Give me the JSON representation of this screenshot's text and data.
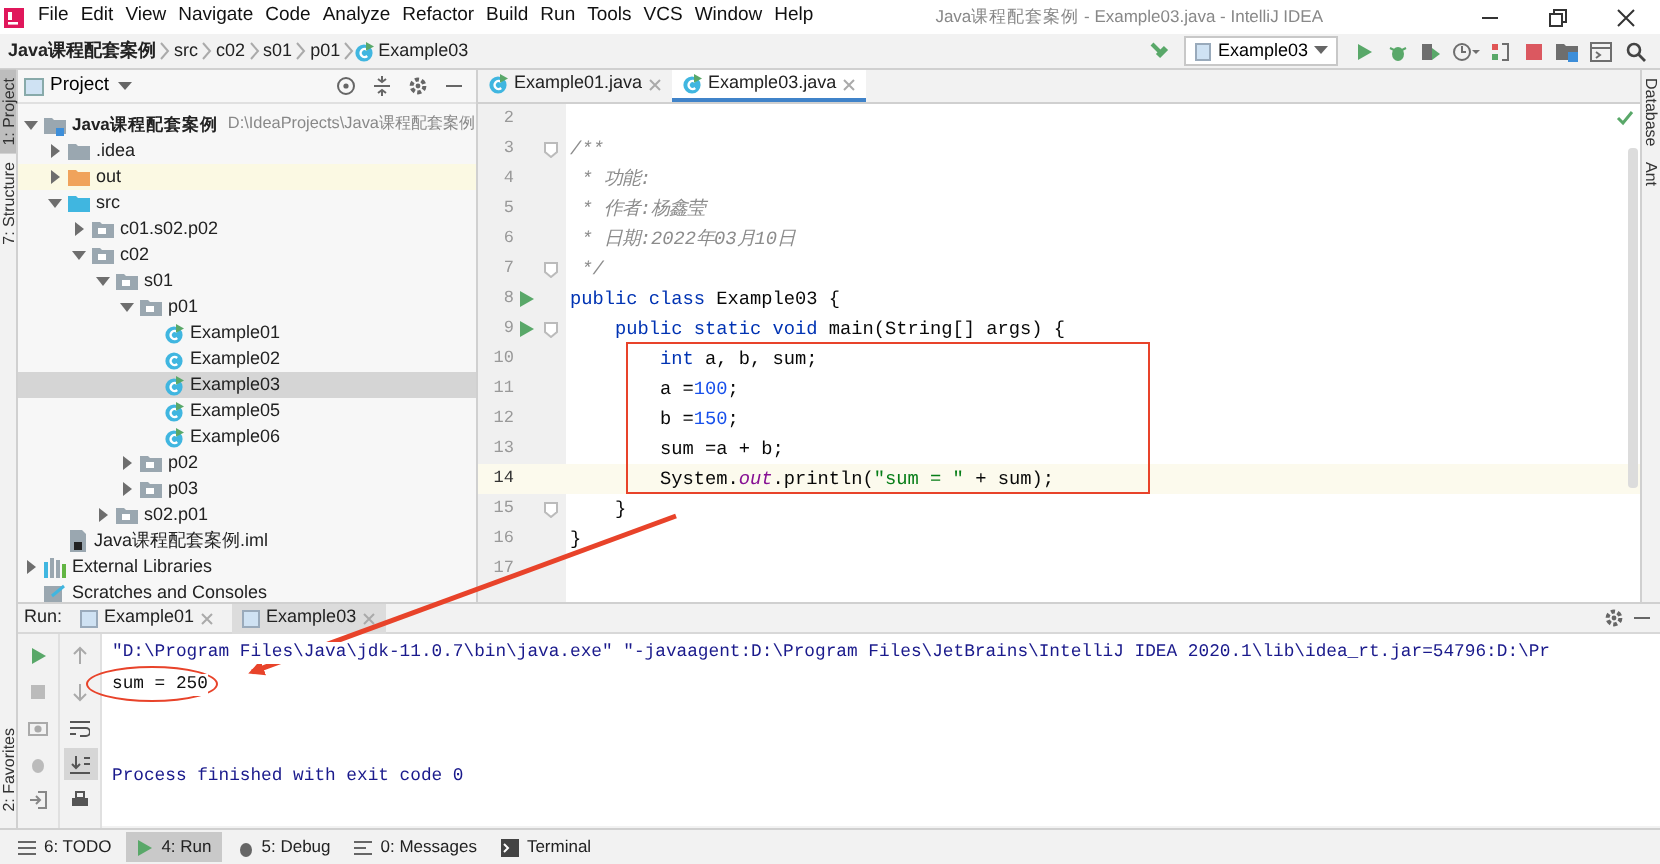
{
  "window": {
    "title": "Java课程配套案例 - Example03.java - IntelliJ IDEA"
  },
  "menu": [
    "File",
    "Edit",
    "View",
    "Navigate",
    "Code",
    "Analyze",
    "Refactor",
    "Build",
    "Run",
    "Tools",
    "VCS",
    "Window",
    "Help"
  ],
  "breadcrumb": [
    {
      "label": "Java课程配套案例",
      "kind": "project"
    },
    {
      "label": "src",
      "kind": "folder"
    },
    {
      "label": "c02",
      "kind": "folder"
    },
    {
      "label": "s01",
      "kind": "folder"
    },
    {
      "label": "p01",
      "kind": "folder"
    },
    {
      "label": "Example03",
      "kind": "class"
    }
  ],
  "run_config": "Example03",
  "left_strip": [
    {
      "label": "1: Project",
      "selected": true
    },
    {
      "label": "7: Structure",
      "selected": false
    }
  ],
  "favorites": "2: Favorites",
  "project_panel": {
    "title": "Project",
    "tree": [
      {
        "label": "Java课程配套案例",
        "path": "D:\\IdeaProjects\\Java课程配套案例",
        "kind": "module",
        "expanded": true,
        "selected": false,
        "children": [
          {
            "label": ".idea",
            "kind": "folder",
            "expanded": false,
            "selected": false
          },
          {
            "label": "out",
            "kind": "excluded",
            "expanded": false,
            "selected": false
          },
          {
            "label": "src",
            "kind": "source",
            "expanded": true,
            "selected": false,
            "children": [
              {
                "label": "c01.s02.p02",
                "kind": "package",
                "expanded": false,
                "selected": false
              },
              {
                "label": "c02",
                "kind": "package",
                "expanded": true,
                "selected": false,
                "children": [
                  {
                    "label": "s01",
                    "kind": "package",
                    "expanded": true,
                    "selected": false,
                    "children": [
                      {
                        "label": "p01",
                        "kind": "package",
                        "expanded": true,
                        "selected": false,
                        "children": [
                          {
                            "label": "Example01",
                            "kind": "main-class",
                            "selected": false
                          },
                          {
                            "label": "Example02",
                            "kind": "class",
                            "selected": false
                          },
                          {
                            "label": "Example03",
                            "kind": "main-class",
                            "selected": true
                          },
                          {
                            "label": "Example05",
                            "kind": "main-class",
                            "selected": false
                          },
                          {
                            "label": "Example06",
                            "kind": "main-class",
                            "selected": false
                          }
                        ]
                      },
                      {
                        "label": "p02",
                        "kind": "package",
                        "expanded": false,
                        "selected": false
                      },
                      {
                        "label": "p03",
                        "kind": "package",
                        "expanded": false,
                        "selected": false
                      }
                    ]
                  },
                  {
                    "label": "s02.p01",
                    "kind": "package",
                    "expanded": false,
                    "selected": false
                  }
                ]
              }
            ]
          },
          {
            "label": "Java课程配套案例.iml",
            "kind": "iml",
            "selected": false
          }
        ]
      },
      {
        "label": "External Libraries",
        "kind": "libraries",
        "expanded": false,
        "selected": false
      },
      {
        "label": "Scratches and Consoles",
        "kind": "scratches",
        "selected": false
      }
    ]
  },
  "editor_tabs": [
    {
      "label": "Example01.java",
      "selected": false
    },
    {
      "label": "Example03.java",
      "selected": true
    }
  ],
  "code_lines": [
    {
      "number": "2",
      "run": false,
      "fold": false,
      "current": false
    },
    {
      "number": "3",
      "run": false,
      "fold": true,
      "current": false,
      "segments": [
        {
          "kind": "comment",
          "text": "/**"
        }
      ]
    },
    {
      "number": "4",
      "run": false,
      "fold": false,
      "current": false,
      "segments": [
        {
          "kind": "comment",
          "text": " * 功能:"
        }
      ]
    },
    {
      "number": "5",
      "run": false,
      "fold": false,
      "current": false,
      "segments": [
        {
          "kind": "comment",
          "text": " * 作者:杨鑫莹"
        }
      ]
    },
    {
      "number": "6",
      "run": false,
      "fold": false,
      "current": false,
      "segments": [
        {
          "kind": "comment",
          "text": " * 日期:2022年03月10日"
        }
      ]
    },
    {
      "number": "7",
      "run": false,
      "fold": true,
      "current": false,
      "segments": [
        {
          "kind": "comment",
          "text": " */"
        }
      ]
    },
    {
      "number": "8",
      "run": true,
      "fold": false,
      "current": false,
      "segments": [
        {
          "kind": "keyword",
          "text": "public class "
        },
        {
          "kind": "plain",
          "text": "Example03 {"
        }
      ]
    },
    {
      "number": "9",
      "run": true,
      "fold": true,
      "current": false,
      "segments": [
        {
          "kind": "keyword",
          "text": "    public static void "
        },
        {
          "kind": "plain",
          "text": "main(String[] args) {"
        }
      ]
    },
    {
      "number": "10",
      "run": false,
      "fold": false,
      "current": false,
      "segments": [
        {
          "kind": "keyword",
          "text": "        int "
        },
        {
          "kind": "plain",
          "text": "a, b, sum;"
        }
      ]
    },
    {
      "number": "11",
      "run": false,
      "fold": false,
      "current": false,
      "segments": [
        {
          "kind": "plain",
          "text": "        a ="
        },
        {
          "kind": "number",
          "text": "100"
        },
        {
          "kind": "plain",
          "text": ";"
        }
      ]
    },
    {
      "number": "12",
      "run": false,
      "fold": false,
      "current": false,
      "segments": [
        {
          "kind": "plain",
          "text": "        b ="
        },
        {
          "kind": "number",
          "text": "150"
        },
        {
          "kind": "plain",
          "text": ";"
        }
      ]
    },
    {
      "number": "13",
      "run": false,
      "fold": false,
      "current": false,
      "segments": [
        {
          "kind": "plain",
          "text": "        sum =a + b;"
        }
      ]
    },
    {
      "number": "14",
      "run": false,
      "fold": false,
      "current": true,
      "segments": [
        {
          "kind": "plain",
          "text": "        System."
        },
        {
          "kind": "static-field",
          "text": "out"
        },
        {
          "kind": "plain",
          "text": ".println("
        },
        {
          "kind": "string",
          "text": "\"sum = \""
        },
        {
          "kind": "plain",
          "text": " + sum);"
        }
      ]
    },
    {
      "number": "15",
      "run": false,
      "fold": true,
      "current": false,
      "segments": [
        {
          "kind": "plain",
          "text": "    }"
        }
      ]
    },
    {
      "number": "16",
      "run": false,
      "fold": false,
      "current": false,
      "segments": [
        {
          "kind": "plain",
          "text": "}"
        }
      ]
    },
    {
      "number": "17",
      "run": false,
      "fold": false,
      "current": false
    }
  ],
  "right_strip": [
    "Database",
    "Ant"
  ],
  "run_panel": {
    "label": "Run:",
    "tabs": [
      {
        "label": "Example01",
        "selected": false
      },
      {
        "label": "Example03",
        "selected": true
      }
    ],
    "console": [
      {
        "kind": "command",
        "text": "\"D:\\Program Files\\Java\\jdk-11.0.7\\bin\\java.exe\" \"-javaagent:D:\\Program Files\\JetBrains\\IntelliJ IDEA 2020.1\\lib\\idea_rt.jar=54796:D:\\Pr"
      },
      {
        "kind": "output",
        "text": "sum = 250"
      },
      {
        "kind": "system",
        "text": "Process finished with exit code 0"
      }
    ]
  },
  "bottom_tools": [
    {
      "label": "6: TODO",
      "selected": false
    },
    {
      "label": "4: Run",
      "selected": true
    },
    {
      "label": "5: Debug",
      "selected": false
    },
    {
      "label": "0: Messages",
      "selected": false
    },
    {
      "label": "Terminal",
      "selected": false
    }
  ]
}
